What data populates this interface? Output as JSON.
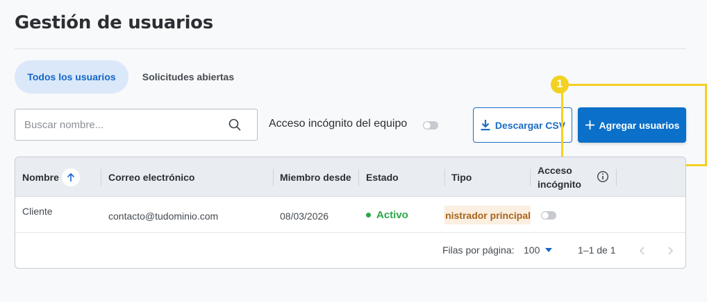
{
  "page": {
    "title": "Gestión de usuarios"
  },
  "tabs": [
    {
      "label": "Todos los usuarios",
      "active": true
    },
    {
      "label": "Solicitudes abiertas",
      "active": false
    }
  ],
  "toolbar": {
    "search_placeholder": "Buscar nombre...",
    "incognito_label": "Acceso incógnito del equipo",
    "incognito_enabled": false,
    "csv_label": "Descargar CSV",
    "add_label": "Agregar usuarios"
  },
  "callout": {
    "step": "1",
    "color": "#f3d122"
  },
  "table": {
    "columns": [
      "Nombre",
      "Correo electrónico",
      "Miembro desde",
      "Estado",
      "Tipo",
      "Acceso incógnito"
    ],
    "rows": [
      {
        "name": "Cliente",
        "email": "contacto@tudominio.com",
        "member_since": "08/03/2026",
        "status": "Activo",
        "type": "Administrador principal",
        "incognito": false
      }
    ]
  },
  "pagination": {
    "rows_per_page_label": "Filas por página:",
    "rows_per_page": "100",
    "range": "1–1 de 1"
  },
  "colors": {
    "primary": "#0b70c9",
    "status_active": "#2aa847",
    "type_badge_bg": "#fbefe1",
    "type_badge_text": "#a6641d"
  }
}
